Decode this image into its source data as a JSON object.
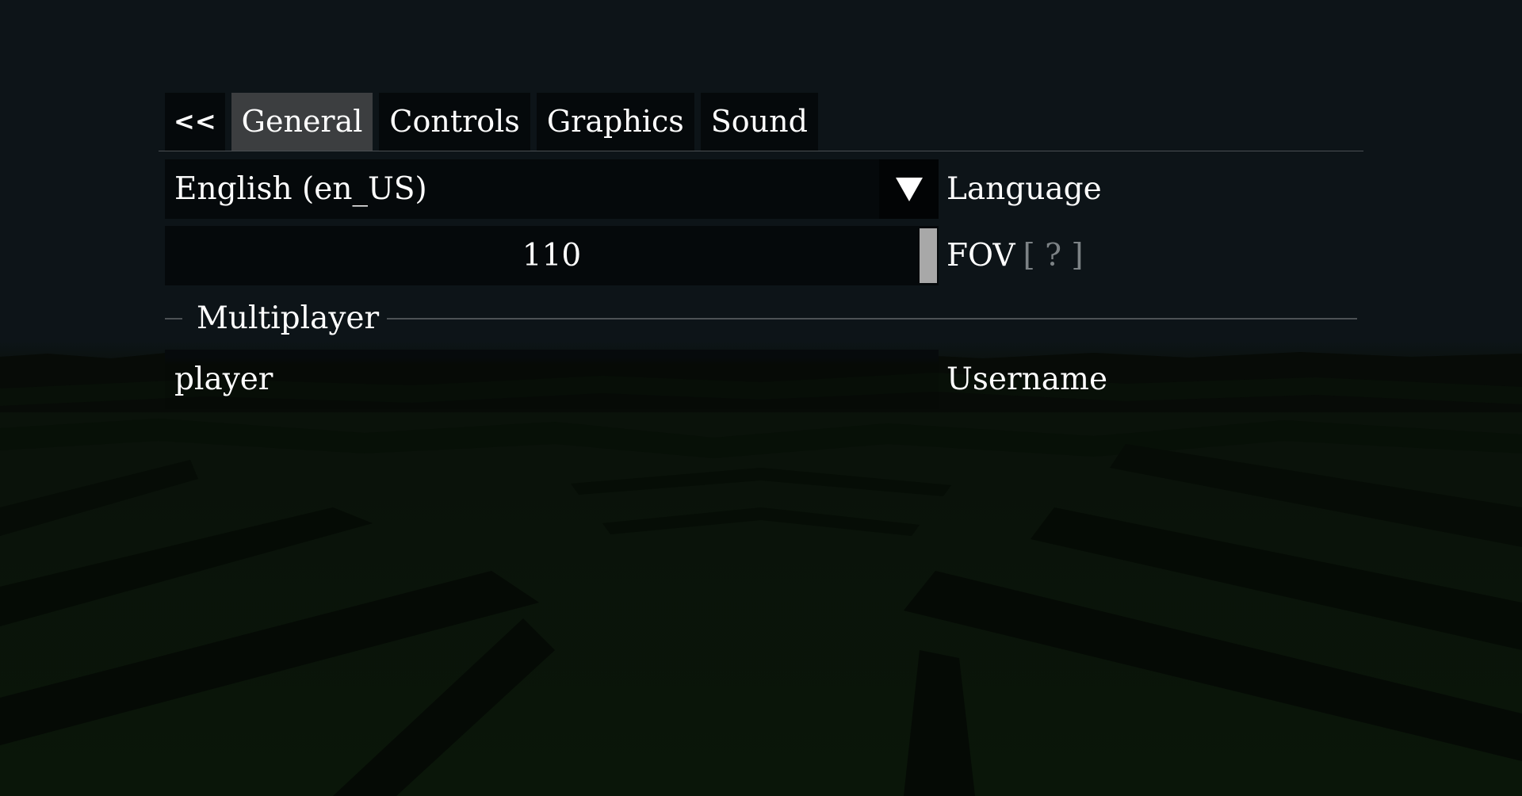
{
  "tabs": {
    "back_label": "<<",
    "items": [
      {
        "label": "General",
        "active": true
      },
      {
        "label": "Controls",
        "active": false
      },
      {
        "label": "Graphics",
        "active": false
      },
      {
        "label": "Sound",
        "active": false
      }
    ]
  },
  "general": {
    "language": {
      "label": "Language",
      "value": "English (en_US)",
      "arrow_icon": "triangle-down-icon"
    },
    "fov": {
      "label": "FOV",
      "help": "[ ? ]",
      "value": "110",
      "level_fraction": 1.0
    },
    "multiplayer": {
      "section_title": "Multiplayer",
      "username": {
        "label": "Username",
        "value": "player"
      }
    }
  },
  "colors": {
    "tab_active": "#3c3e40",
    "field_bg": "#05090b",
    "slider_thumb": "#a8a8a8",
    "help_text": "#7c8285"
  }
}
